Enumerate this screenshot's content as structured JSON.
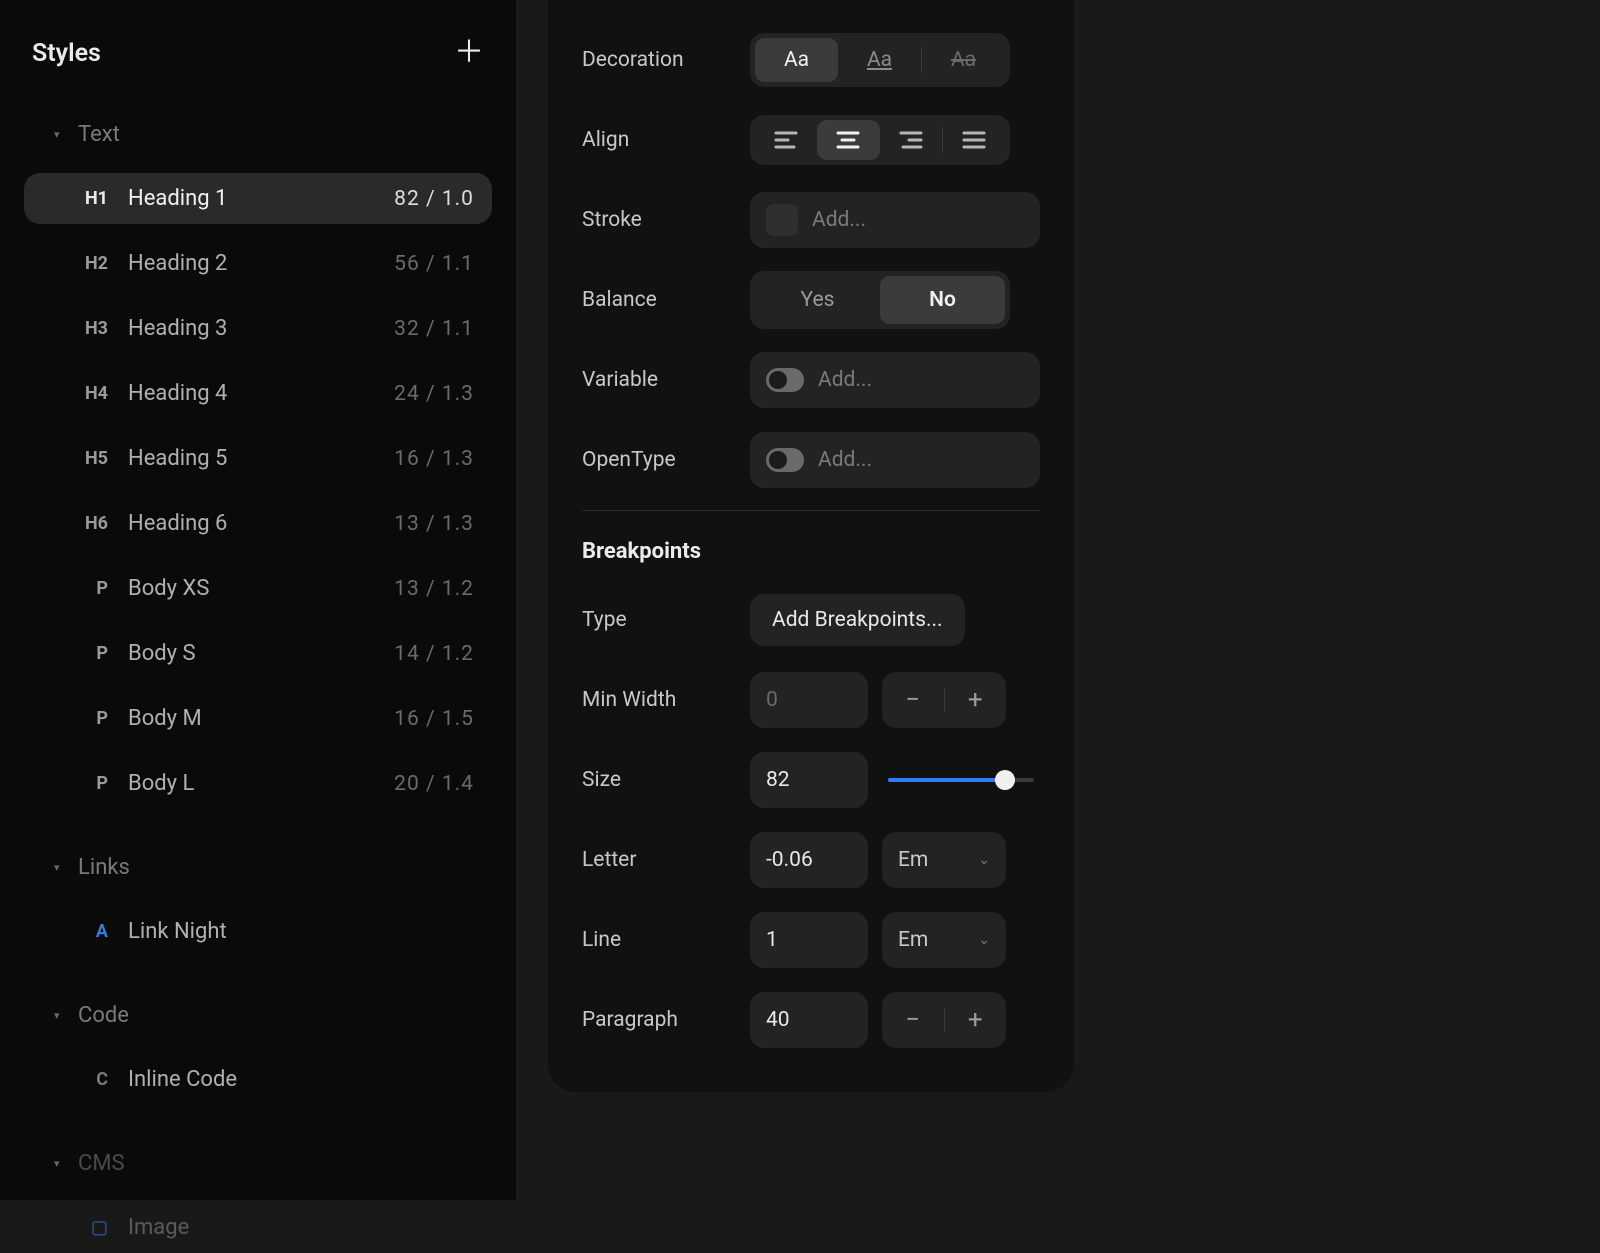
{
  "sidebar": {
    "title": "Styles",
    "add": "＋",
    "sections": {
      "text": {
        "label": "Text",
        "tri": "▾"
      },
      "links": {
        "label": "Links",
        "tri": "▾"
      },
      "code": {
        "label": "Code",
        "tri": "▾"
      },
      "cms": {
        "label": "CMS",
        "tri": "▾"
      }
    },
    "text_items": [
      {
        "tag": "H1",
        "name": "Heading 1",
        "meta": "82 / 1.0"
      },
      {
        "tag": "H2",
        "name": "Heading 2",
        "meta": "56 / 1.1"
      },
      {
        "tag": "H3",
        "name": "Heading 3",
        "meta": "32 / 1.1"
      },
      {
        "tag": "H4",
        "name": "Heading 4",
        "meta": "24 / 1.3"
      },
      {
        "tag": "H5",
        "name": "Heading 5",
        "meta": "16 / 1.3"
      },
      {
        "tag": "H6",
        "name": "Heading 6",
        "meta": "13 / 1.3"
      },
      {
        "tag": "P",
        "name": "Body XS",
        "meta": "13 / 1.2"
      },
      {
        "tag": "P",
        "name": "Body S",
        "meta": "14 / 1.2"
      },
      {
        "tag": "P",
        "name": "Body M",
        "meta": "16 / 1.5"
      },
      {
        "tag": "P",
        "name": "Body L",
        "meta": "20 / 1.4"
      }
    ],
    "links_items": [
      {
        "tag": "A",
        "name": "Link Night"
      }
    ],
    "code_items": [
      {
        "tag": "C",
        "name": "Inline Code"
      }
    ],
    "cms_items": [
      {
        "tag": "▢",
        "name": "Image"
      }
    ]
  },
  "props": {
    "decoration": {
      "label": "Decoration",
      "a": "Aa",
      "b": "Aa",
      "c": "Aa"
    },
    "align": {
      "label": "Align"
    },
    "stroke": {
      "label": "Stroke",
      "placeholder": "Add..."
    },
    "balance": {
      "label": "Balance",
      "yes": "Yes",
      "no": "No"
    },
    "variable": {
      "label": "Variable",
      "placeholder": "Add..."
    },
    "opentype": {
      "label": "OpenType",
      "placeholder": "Add..."
    }
  },
  "bp": {
    "heading": "Breakpoints",
    "type": {
      "label": "Type",
      "btn": "Add Breakpoints..."
    },
    "minwidth": {
      "label": "Min Width",
      "placeholder": "0"
    },
    "size": {
      "label": "Size",
      "value": "82",
      "fill_pct": 80
    },
    "letter": {
      "label": "Letter",
      "value": "-0.06",
      "unit": "Em"
    },
    "line": {
      "label": "Line",
      "value": "1",
      "unit": "Em"
    },
    "paragraph": {
      "label": "Paragraph",
      "value": "40"
    },
    "minus": "−",
    "plus": "+"
  }
}
